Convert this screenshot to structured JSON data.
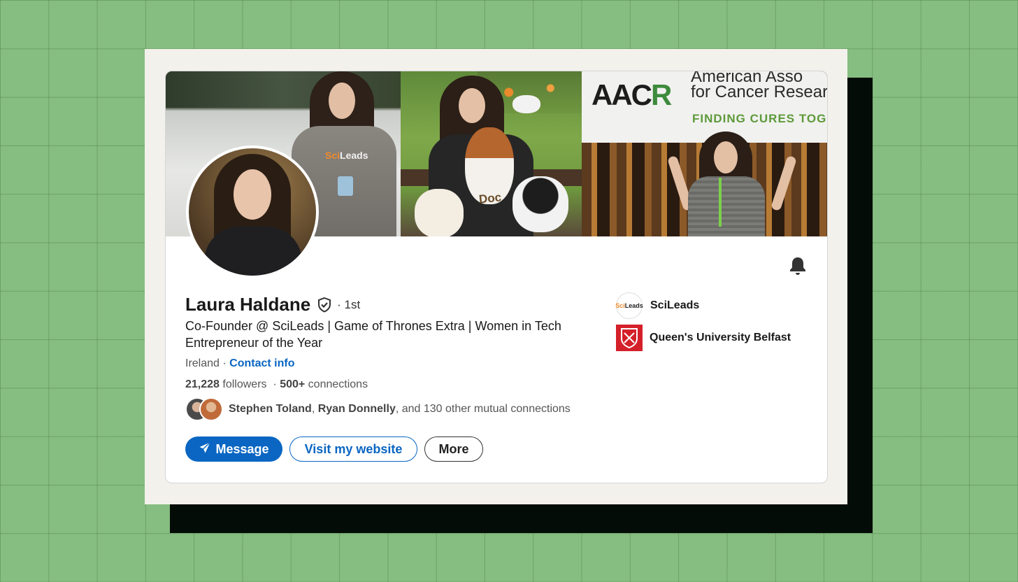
{
  "profile": {
    "name": "Laura Haldane",
    "degree": "· 1st",
    "headline": "Co-Founder @ SciLeads | Game of Thrones Extra | Women in Tech Entrepreneur of the Year",
    "location": "Ireland",
    "location_sep": " · ",
    "contact_info": "Contact info",
    "followers_count": "21,228",
    "followers_label": " followers",
    "connections_sep": "  · ",
    "connections_count": "500+",
    "connections_label": " connections",
    "mutual": {
      "name1": "Stephen Toland",
      "sep": ", ",
      "name2": "Ryan Donnelly",
      "rest": ", and 130 other mutual connections"
    }
  },
  "actions": {
    "message": "Message",
    "website": "Visit my website",
    "more": "More"
  },
  "organizations": [
    {
      "name": "SciLeads",
      "logo_text_a": "Sci",
      "logo_text_b": "Leads"
    },
    {
      "name": "Queen's University Belfast"
    }
  ],
  "banner": {
    "hoodie_a": "Sci",
    "hoodie_b": "Leads",
    "doc": "Doc",
    "aacr_a": "AAC",
    "aacr_b": "R",
    "aacr_line1": "American Asso",
    "aacr_line2": "for Cancer Researc",
    "aacr_line3": "FINDING CURES TOG"
  },
  "colors": {
    "accent": "#0a66c2",
    "background": "#86bd80",
    "frame": "#f3f1ec",
    "shadow": "#030c06"
  },
  "icons": [
    "bell-icon",
    "verified-shield-icon",
    "send-icon"
  ]
}
